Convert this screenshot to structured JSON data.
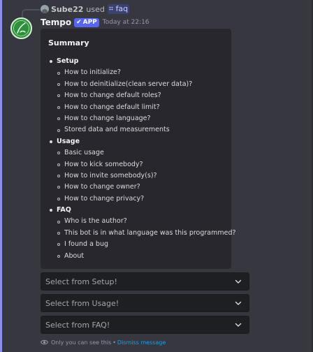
{
  "reply": {
    "username": "Sube22",
    "used_text": "used",
    "command": "faq"
  },
  "author": {
    "name": "Tempo",
    "badge": "APP",
    "timestamp": "Today at 22:16"
  },
  "embed": {
    "title": "Summary",
    "sections": [
      {
        "name": "Setup",
        "items": [
          "How to initialize?",
          "How to deinitialize(clean server data)?",
          "How to change default roles?",
          "How to change default limit?",
          "How to change language?",
          "Stored data and measurements"
        ]
      },
      {
        "name": "Usage",
        "items": [
          "Basic usage",
          "How to kick somebody?",
          "How to invite somebody(s)?",
          "How to change owner?",
          "How to change privacy?"
        ]
      },
      {
        "name": "FAQ",
        "items": [
          "Who is the author?",
          "This bot is in what language was this programmed?",
          "I found a bug",
          "About"
        ]
      }
    ]
  },
  "selects": [
    {
      "placeholder": "Select from Setup!"
    },
    {
      "placeholder": "Select from Usage!"
    },
    {
      "placeholder": "Select from FAQ!"
    }
  ],
  "ephemeral": {
    "note": "Only you can see this",
    "separator": "•",
    "dismiss": "Dismiss message"
  },
  "colors": {
    "background": "#37373f",
    "embed_bg": "#27272d",
    "app_badge": "#5865f2",
    "link": "#00a8fc",
    "mention_accent": "#8b8fe8",
    "avatar_green": "#2e8f3c"
  },
  "icons": {
    "reply_avatar": "user-avatar-icon",
    "command": "slash-command-icon",
    "badge_check": "checkmark-icon",
    "select_chevron": "chevron-down-icon",
    "ephemeral": "eye-icon"
  }
}
